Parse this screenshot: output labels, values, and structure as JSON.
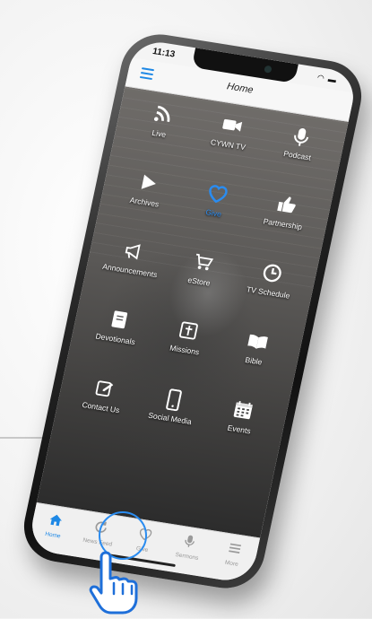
{
  "status": {
    "time": "11:13"
  },
  "navbar": {
    "title": "Home",
    "menu_icon": "hamburger-icon"
  },
  "grid": {
    "items": [
      {
        "label": "Live",
        "icon": "rss-icon"
      },
      {
        "label": "CYWN TV",
        "icon": "video-camera-icon"
      },
      {
        "label": "Podcast",
        "icon": "microphone-icon"
      },
      {
        "label": "Archives",
        "icon": "play-icon"
      },
      {
        "label": "Give",
        "icon": "heart-icon"
      },
      {
        "label": "Partnership",
        "icon": "thumbs-up-icon"
      },
      {
        "label": "Announcements",
        "icon": "megaphone-icon"
      },
      {
        "label": "eStore",
        "icon": "cart-icon"
      },
      {
        "label": "TV Schedule",
        "icon": "clock-icon"
      },
      {
        "label": "Devotionals",
        "icon": "book-icon"
      },
      {
        "label": "Missions",
        "icon": "cross-icon"
      },
      {
        "label": "Bible",
        "icon": "open-book-icon"
      },
      {
        "label": "Contact Us",
        "icon": "edit-icon"
      },
      {
        "label": "Social Media",
        "icon": "phone-icon"
      },
      {
        "label": "Events",
        "icon": "calendar-icon"
      }
    ]
  },
  "tabbar": {
    "tabs": [
      {
        "label": "Home",
        "icon": "home-icon"
      },
      {
        "label": "News Feed",
        "icon": "refresh-icon"
      },
      {
        "label": "Give",
        "icon": "heart-outline-icon"
      },
      {
        "label": "Sermons",
        "icon": "microphone-icon"
      },
      {
        "label": "More",
        "icon": "menu-icon"
      }
    ]
  },
  "colors": {
    "accent": "#1e88e5",
    "give": "#2a8cf0",
    "frame": "#1a1a1a"
  }
}
